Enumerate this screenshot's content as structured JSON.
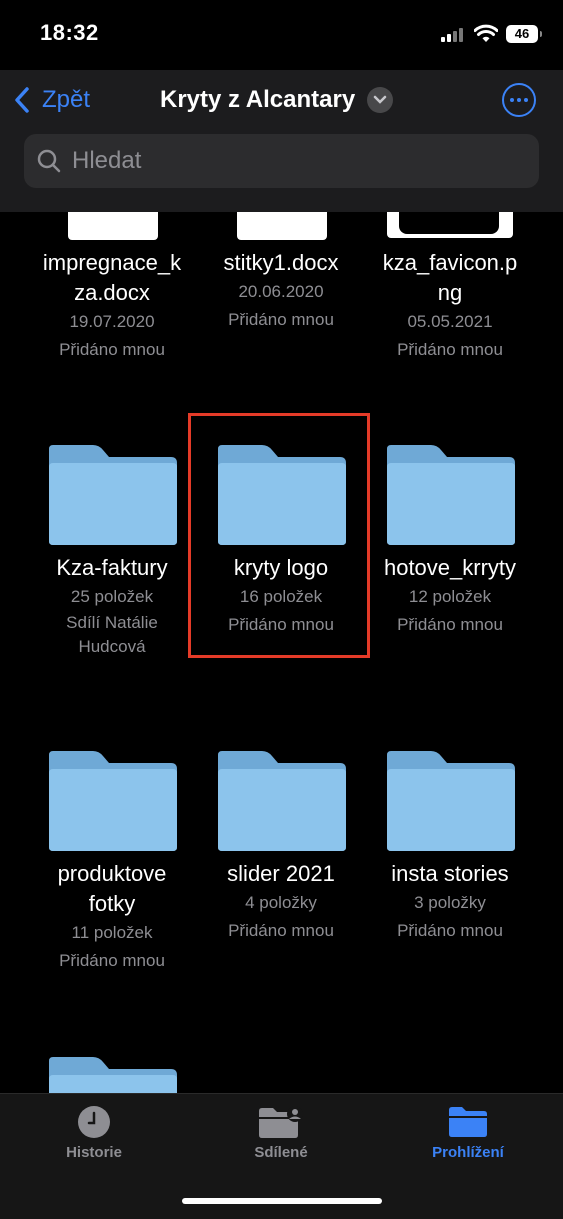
{
  "status": {
    "time": "18:32",
    "battery": "46"
  },
  "nav": {
    "back_label": "Zpět",
    "title": "Kryty z Alcantary",
    "search_placeholder": "Hledat"
  },
  "files": [
    {
      "name_line1": "impregnace_k",
      "name_line2": "za.docx",
      "date": "19.07.2020",
      "owner": "Přidáno mnou"
    },
    {
      "name_line1": "stitky1.docx",
      "date": "20.06.2020",
      "owner": "Přidáno mnou"
    },
    {
      "name_line1": "kza_favicon.p",
      "name_line2": "ng",
      "date": "05.05.2021",
      "owner": "Přidáno mnou"
    }
  ],
  "folders": [
    {
      "name_line1": "Kza-faktury",
      "count": "25 položek",
      "owner_line1": "Sdílí Natálie",
      "owner_line2": "Hudcová"
    },
    {
      "name_line1": "kryty logo",
      "count": "16 položek",
      "owner_line1": "Přidáno mnou"
    },
    {
      "name_line1": "hotove_krryty",
      "count": "12 položek",
      "owner_line1": "Přidáno mnou"
    },
    {
      "name_line1": "produktove",
      "name_line2": "fotky",
      "count": "11 položek",
      "owner_line1": "Přidáno mnou"
    },
    {
      "name_line1": "slider 2021",
      "count": "4 položky",
      "owner_line1": "Přidáno mnou"
    },
    {
      "name_line1": "insta stories",
      "count": "3 položky",
      "owner_line1": "Přidáno mnou"
    }
  ],
  "tabs": [
    {
      "label": "Historie",
      "icon": "clock-icon"
    },
    {
      "label": "Sdílené",
      "icon": "shared-folder-icon"
    },
    {
      "label": "Prohlížení",
      "icon": "folder-icon",
      "active": true
    }
  ],
  "colors": {
    "accent": "#3b82f6",
    "highlight": "#e53b28",
    "folder": "#8cc4ec"
  }
}
